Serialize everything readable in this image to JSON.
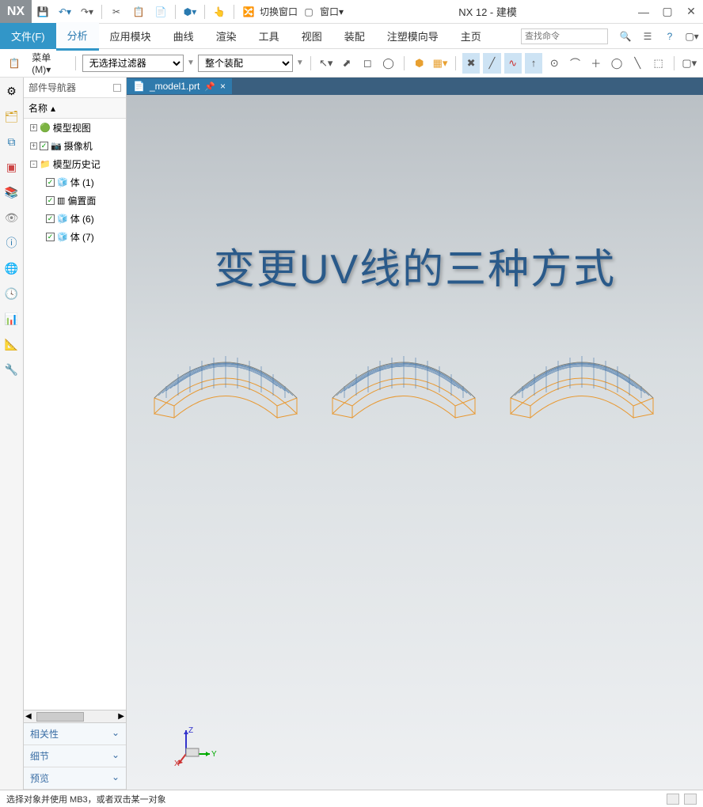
{
  "app": {
    "name": "NX",
    "title": "NX 12 - 建模"
  },
  "titlebar_buttons": {
    "switch_window": "切换窗口",
    "window": "窗口"
  },
  "menubar": {
    "file": "文件(F)",
    "tabs": [
      "分析",
      "应用模块",
      "曲线",
      "渲染",
      "工具",
      "视图",
      "装配",
      "注塑模向导",
      "主页"
    ],
    "active_index": 0,
    "search_placeholder": "查找命令"
  },
  "toolbar2": {
    "menu_label": "菜单(M)",
    "filter1": "无选择过滤器",
    "filter2": "整个装配"
  },
  "navigator": {
    "title": "部件导航器",
    "column": "名称",
    "items": [
      {
        "level": 1,
        "expand": "+",
        "check": false,
        "icon": "🟢",
        "label": "模型视图"
      },
      {
        "level": 1,
        "expand": "+",
        "check": true,
        "icon": "📷",
        "label": "摄像机"
      },
      {
        "level": 1,
        "expand": "-",
        "check": false,
        "icon": "📁",
        "label": "模型历史记"
      },
      {
        "level": 2,
        "expand": "",
        "check": true,
        "icon": "🧊",
        "label": "体 (1)"
      },
      {
        "level": 2,
        "expand": "",
        "check": true,
        "icon": "▥",
        "label": "偏置面"
      },
      {
        "level": 2,
        "expand": "",
        "check": true,
        "icon": "🧊",
        "label": "体 (6)"
      },
      {
        "level": 2,
        "expand": "",
        "check": true,
        "icon": "🧊",
        "label": "体 (7)"
      }
    ],
    "bottom_tabs": [
      "相关性",
      "细节",
      "预览"
    ]
  },
  "file_tab": {
    "name": "_model1.prt",
    "pin": "📌"
  },
  "overlay_text": "变更UV线的三种方式",
  "csys": {
    "x": "X",
    "y": "Y",
    "z": "Z"
  },
  "statusbar": {
    "text": "选择对象并使用 MB3，或者双击某一对象"
  }
}
